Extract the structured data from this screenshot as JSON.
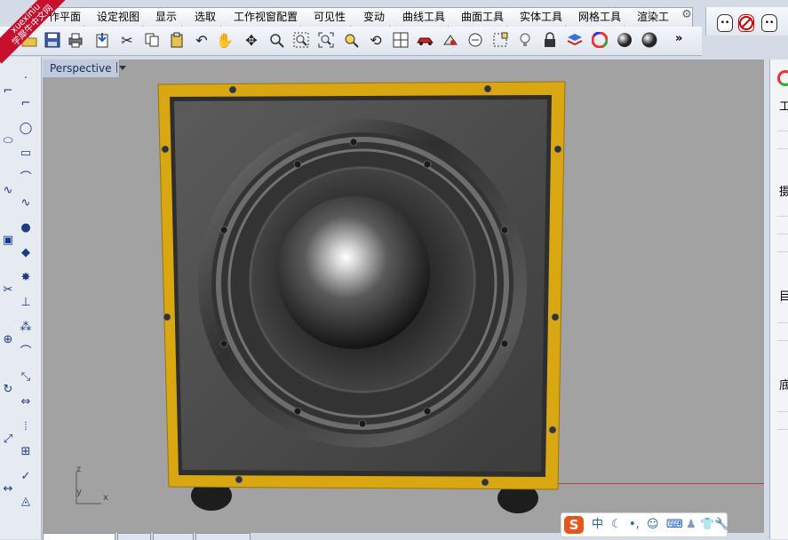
{
  "tabs": [
    "作平面",
    "设定视图",
    "显示",
    "选取",
    "工作视窗配置",
    "可见性",
    "变动",
    "曲线工具",
    "曲面工具",
    "实体工具",
    "网格工具",
    "渲染工"
  ],
  "toolbar": {
    "more_label": "»",
    "icons": [
      "open-folder-icon",
      "save-icon",
      "print-icon",
      "import-icon",
      "cut-icon",
      "copy-icon",
      "paste-icon",
      "undo-icon",
      "pan-hand-icon",
      "rotate-view-icon",
      "zoom-icon",
      "zoom-window-icon",
      "zoom-extents-icon",
      "zoom-selected-icon",
      "rotate-camera-icon",
      "four-viewports-icon",
      "car-icon",
      "render-preview-icon",
      "snap-icon",
      "object-snap-icon",
      "light-bulb-icon",
      "lock-icon",
      "layer-icon",
      "color-wheel-icon",
      "material-sphere-icon",
      "render-sphere-icon"
    ]
  },
  "watermark": {
    "line1": "xuexiniu",
    "line2": "学犀牛中文网"
  },
  "viewport": {
    "title": "Perspective",
    "axis_z": "z",
    "axis_y": "y",
    "axis_x": "x"
  },
  "right_panel": {
    "labels": [
      "工",
      "摄",
      "目",
      "底"
    ]
  },
  "ime": {
    "logo": "S",
    "mode": "中",
    "items": [
      "moon-icon",
      "comma-icon",
      "emoji-icon",
      "keyboard-icon",
      "user-icon",
      "shirt-icon",
      "wrench-icon"
    ]
  },
  "colors": {
    "speaker_frame": "#d9a712",
    "viewport_bg": "#a2a2a2",
    "accent": "#1d5fbd"
  }
}
